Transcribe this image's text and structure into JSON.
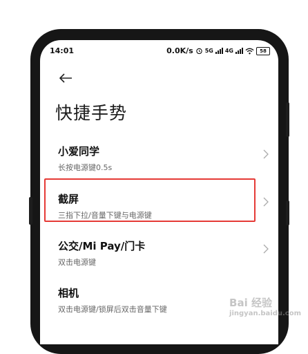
{
  "status_bar": {
    "time": "14:01",
    "speed": "0.0K/s",
    "alarm_icon": "alarm-clock-icon",
    "net1": "5G",
    "net2": "4G",
    "wifi_icon": "wifi-icon",
    "battery": "58"
  },
  "header": {
    "back_icon": "arrow-left-icon",
    "title": "快捷手势"
  },
  "items": [
    {
      "label": "小爱同学",
      "sub": "长按电源键0.5s"
    },
    {
      "label": "截屏",
      "sub": "三指下拉/音量下键与电源键"
    },
    {
      "label": "公交/Mi Pay/门卡",
      "sub": "双击电源键"
    },
    {
      "label": "相机",
      "sub": "双击电源键/锁屏后双击音量下键"
    }
  ],
  "annotation": {
    "color": "#e53935"
  },
  "watermark": {
    "text": "Bai 经验",
    "sub": "jingyan.baidu.com"
  }
}
